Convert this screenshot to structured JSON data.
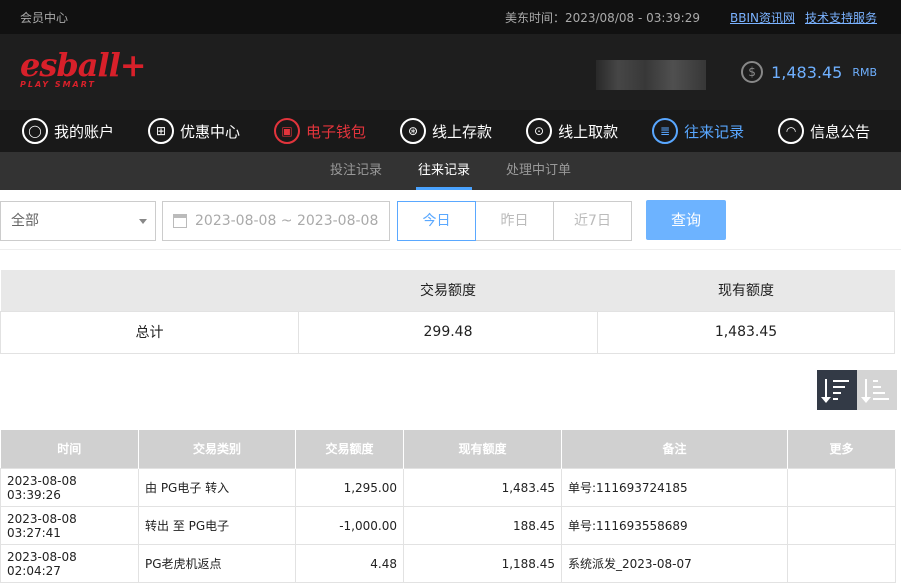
{
  "topbar": {
    "member_center": "会员中心",
    "time_label": "美东时间：",
    "time_value": "2023/08/08 - 03:39:29",
    "link_bbin": "BBIN资讯网",
    "link_support": "技术支持服务"
  },
  "brand": {
    "logo_text": "esball+",
    "logo_tagline": "PLAY SMART",
    "balance": "1,483.45",
    "currency": "RMB",
    "currency_symbol": "$"
  },
  "nav": [
    {
      "label": "我的账户",
      "icon": "user-icon",
      "glyph": "◯"
    },
    {
      "label": "优惠中心",
      "icon": "gift-icon",
      "glyph": "⊞"
    },
    {
      "label": "电子钱包",
      "icon": "wallet-icon",
      "glyph": "▣"
    },
    {
      "label": "线上存款",
      "icon": "deposit-icon",
      "glyph": "⊛"
    },
    {
      "label": "线上取款",
      "icon": "withdraw-icon",
      "glyph": "⊙"
    },
    {
      "label": "往来记录",
      "icon": "records-icon",
      "glyph": "≣"
    },
    {
      "label": "信息公告",
      "icon": "bell-icon",
      "glyph": "◠"
    }
  ],
  "subnav": [
    {
      "label": "投注记录"
    },
    {
      "label": "往来记录"
    },
    {
      "label": "处理中订单"
    }
  ],
  "filters": {
    "type_selected": "全部",
    "date_range": "2023-08-08 ~ 2023-08-08",
    "quick": [
      "今日",
      "昨日",
      "近7日"
    ],
    "query_label": "查询"
  },
  "summary": {
    "headers": [
      "",
      "交易额度",
      "现有额度"
    ],
    "row_label": "总计",
    "amount": "299.48",
    "balance": "1,483.45"
  },
  "records": {
    "headers": [
      "时间",
      "交易类别",
      "交易额度",
      "现有额度",
      "备注",
      "更多"
    ],
    "rows": [
      [
        "2023-08-08 03:39:26",
        "由 PG电子 转入",
        "1,295.00",
        "1,483.45",
        "单号:111693724185",
        ""
      ],
      [
        "2023-08-08 03:27:41",
        "转出 至 PG电子",
        "-1,000.00",
        "188.45",
        "单号:111693558689",
        ""
      ],
      [
        "2023-08-08 02:04:27",
        "PG老虎机返点",
        "4.48",
        "1,188.45",
        "系统派发_2023-08-07",
        ""
      ]
    ]
  },
  "colors": {
    "brand_red": "#d8202a",
    "accent_blue": "#59a7ff"
  }
}
